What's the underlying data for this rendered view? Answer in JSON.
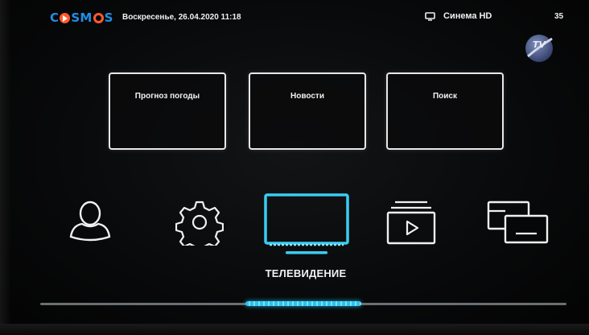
{
  "header": {
    "logo_text": "COSMOS",
    "datetime": "Воскресенье, 26.04.2020  11:18",
    "channel_name": "Синема HD",
    "channel_number": "35",
    "badge_text": "TV"
  },
  "tiles": [
    {
      "label": "Прогноз погоды"
    },
    {
      "label": "Новости"
    },
    {
      "label": "Поиск"
    }
  ],
  "menu": {
    "selected_label": "ТЕЛЕВИДЕНИЕ",
    "items": [
      "profile-icon",
      "settings-gear-icon",
      "television-icon",
      "video-library-icon",
      "windows-icon"
    ]
  },
  "scroll": {
    "position_fraction": 0.39,
    "thumb_fraction": 0.22
  },
  "colors": {
    "accent": "#2bc4ee",
    "logo_blue": "#1f8fe6",
    "logo_orange": "#ff5a2a"
  }
}
